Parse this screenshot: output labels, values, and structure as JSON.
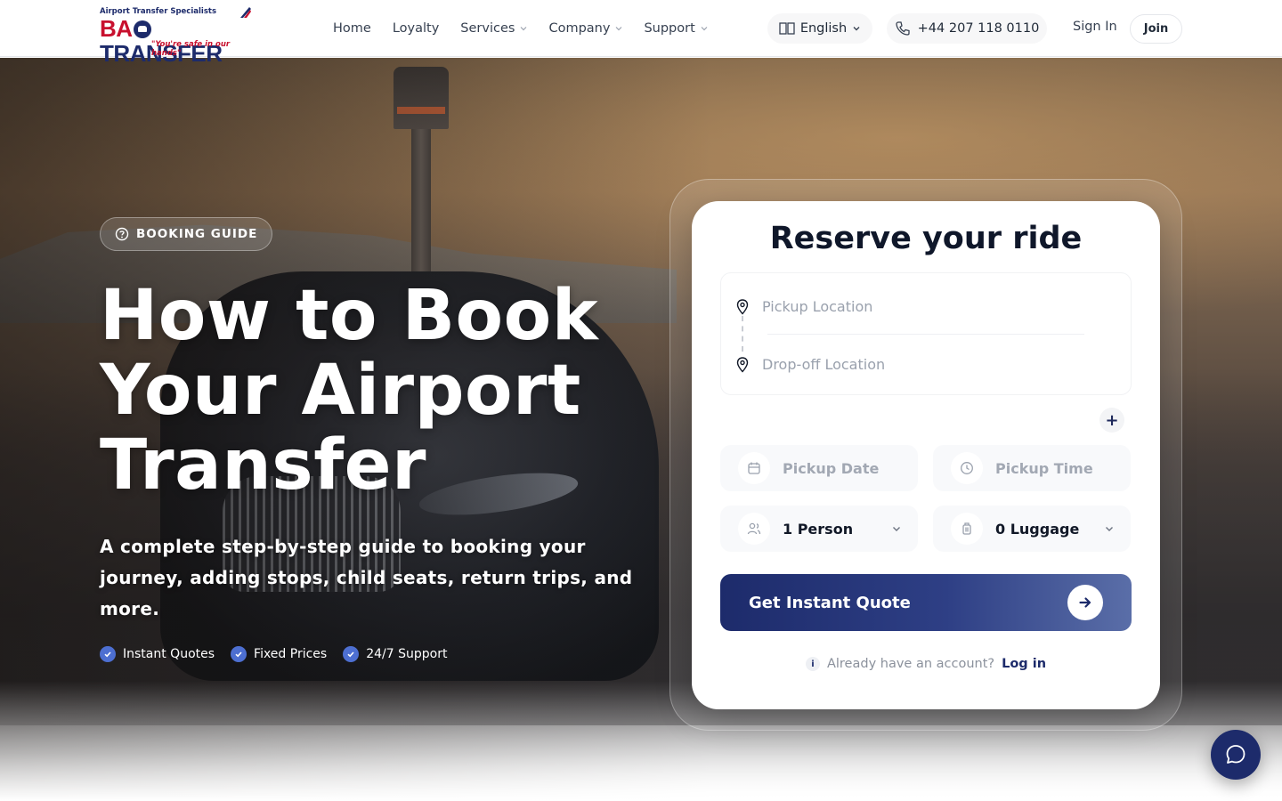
{
  "logo": {
    "tagline_top": "Airport Transfer Specialists",
    "brand_prefix": "BA",
    "brand_suffix": "TRANSFER",
    "tagline_bottom": "\"You're safe in our hands\"",
    "colors": {
      "navy": "#1d2b6b",
      "red": "#c8102e"
    }
  },
  "nav": {
    "items": [
      {
        "label": "Home",
        "dropdown": false
      },
      {
        "label": "Loyalty",
        "dropdown": false
      },
      {
        "label": "Services",
        "dropdown": true
      },
      {
        "label": "Company",
        "dropdown": true
      },
      {
        "label": "Support",
        "dropdown": true
      }
    ]
  },
  "header": {
    "language": "English",
    "phone": "+44 207 118 0110",
    "sign_in": "Sign In",
    "join": "Join"
  },
  "hero": {
    "badge": "BOOKING GUIDE",
    "title_line1": "How to Book",
    "title_line2": "Your Airport",
    "title_line3": "Transfer",
    "subtitle": "A complete step-by-step guide to booking your journey, adding stops, child seats, return trips, and more.",
    "features": [
      "Instant Quotes",
      "Fixed Prices",
      "24/7 Support"
    ]
  },
  "booking": {
    "title": "Reserve your ride",
    "pickup_placeholder": "Pickup Location",
    "dropoff_placeholder": "Drop-off Location",
    "add_stop": "+",
    "date_placeholder": "Pickup Date",
    "time_placeholder": "Pickup Time",
    "passengers": "1 Person",
    "luggage": "0 Luggage",
    "cta": "Get Instant Quote",
    "account_prompt": "Already have an account?",
    "login_link": "Log in",
    "info_glyph": "i"
  },
  "colors": {
    "primary": "#1d2b6b",
    "accent_blue": "#4d6fd1"
  },
  "icons": {
    "badge": "question-circle-icon",
    "language": "book-icon",
    "phone": "phone-icon",
    "pickup": "map-pin-icon",
    "dropoff": "map-pin-icon",
    "date": "calendar-icon",
    "time": "clock-icon",
    "passengers": "users-icon",
    "luggage": "luggage-icon",
    "cta": "arrow-right-icon",
    "chat": "chat-bubble-icon"
  }
}
